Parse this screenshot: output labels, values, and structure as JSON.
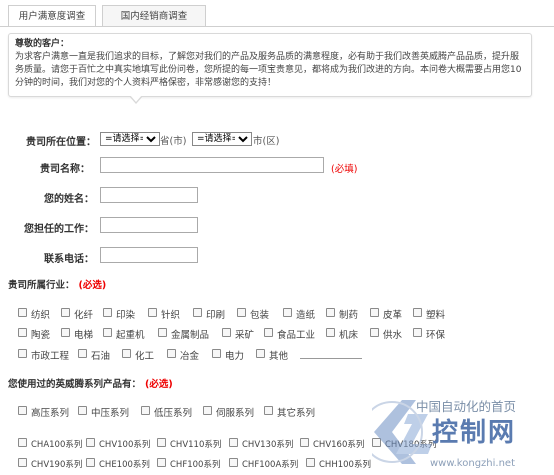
{
  "tabs": [
    "用户满意度调查",
    "国内经销商调查"
  ],
  "intro": {
    "greeting": "尊敬的客户：",
    "body": "为求客户满意一直是我们追求的目标，了解您对我们的产品及服务品质的满意程度，必有助于我们改善英威腾产品品质，提升服务质量。请您于百忙之中真实地填写此份问卷，您所提的每一项宝贵意见，都将成为我们改进的方向。本问卷大概需要占用您10分钟的时间，我们对您的个人资料严格保密，非常感谢您的支持！"
  },
  "location": {
    "label": "贵司所在位置：",
    "province_select": "=请选择=",
    "province_unit": "省(市)",
    "city_select": "=请选择=",
    "city_unit": "市(区)"
  },
  "company": {
    "label": "贵司名称：",
    "required": "(必填)"
  },
  "name": {
    "label": "您的姓名："
  },
  "job": {
    "label": "您担任的工作："
  },
  "phone": {
    "label": "联系电话："
  },
  "industry": {
    "title": "贵司所属行业：",
    "required": "(必选)",
    "rows": [
      [
        "纺织",
        "化纤",
        "印染",
        "针织",
        "印刷",
        "包装",
        "造纸",
        "制药",
        "皮革",
        "塑料"
      ],
      [
        "陶瓷",
        "电梯",
        "起重机",
        "金属制品",
        "采矿",
        "食品工业",
        "机床",
        "供水",
        "环保"
      ],
      [
        "市政工程",
        "石油",
        "化工",
        "冶金",
        "电力",
        "其他"
      ]
    ]
  },
  "products": {
    "title": "您使用过的英威腾系列产品有：",
    "required": "(必选)",
    "series": [
      "高压系列",
      "中压系列",
      "低压系列",
      "伺服系列",
      "其它系列"
    ],
    "models_row1": [
      "CHA100系列",
      "CHV100系列",
      "CHV110系列",
      "CHV130系列",
      "CHV160系列",
      "CHV180系列"
    ],
    "models_row2": [
      "CHV190系列",
      "CHE100系列",
      "CHF100系列",
      "CHF100A系列",
      "CHH100系列"
    ]
  },
  "watermark": {
    "slogan": "中国自动化的首页",
    "name": "控制网",
    "url": "www.kongzhi.net"
  },
  "colors": {
    "required": "#ee0000",
    "border": "#cfcfcf",
    "watermark": "#5a7bb0"
  }
}
